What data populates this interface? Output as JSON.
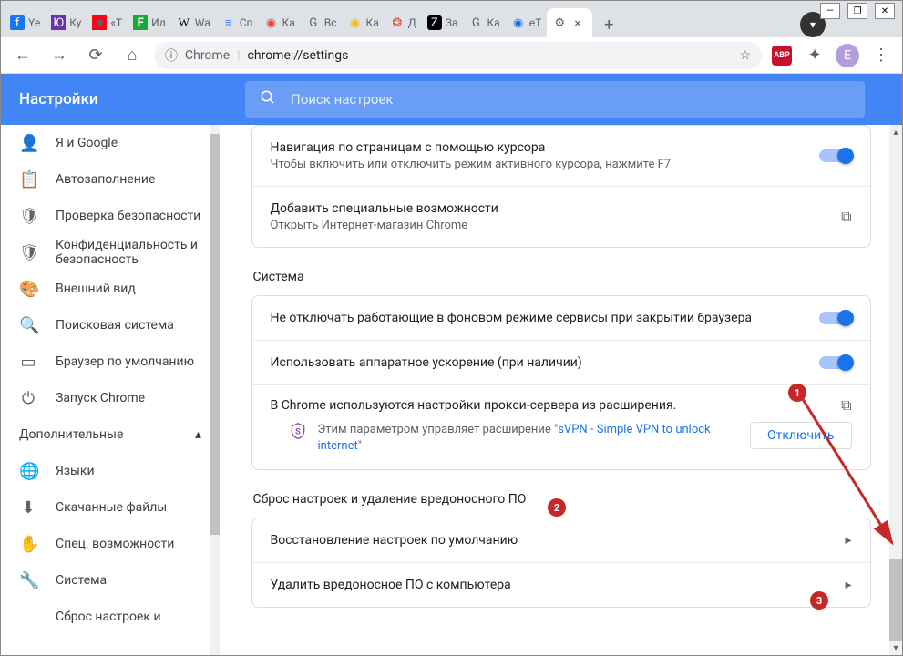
{
  "window": {
    "minimize": "—",
    "maximize": "❐",
    "close": "✕"
  },
  "tabs": [
    {
      "icon": "f",
      "title": "Ye",
      "cls": "fb"
    },
    {
      "icon": "Ю",
      "title": "Ку",
      "cls": "yk"
    },
    {
      "icon": "■",
      "title": "«Т",
      "cls": "red"
    },
    {
      "icon": "F",
      "title": "Ил",
      "cls": "grn"
    },
    {
      "icon": "W",
      "title": "Wa",
      "cls": "wk"
    },
    {
      "icon": "≡",
      "title": "Сп",
      "cls": "gd"
    },
    {
      "icon": "◉",
      "title": "Ка",
      "cls": "mc1"
    },
    {
      "icon": "G",
      "title": "Вс",
      "cls": ""
    },
    {
      "icon": "◉",
      "title": "Ка",
      "cls": "mc2"
    },
    {
      "icon": "❂",
      "title": "Д",
      "cls": "mc3"
    },
    {
      "icon": "Z",
      "title": "За",
      "cls": "zen"
    },
    {
      "icon": "G",
      "title": "Ка",
      "cls": ""
    },
    {
      "icon": "◉",
      "title": "eT",
      "cls": "pl"
    },
    {
      "icon": "⚙",
      "title": "",
      "cls": "gear",
      "active": true
    }
  ],
  "addr": {
    "chrome_label": "Chrome",
    "url": "chrome://settings",
    "abp": "ABP",
    "avatar": "E"
  },
  "header": {
    "title": "Настройки",
    "search_placeholder": "Поиск настроек"
  },
  "sidebar": {
    "items": [
      {
        "icon": "👤",
        "label": "Я и Google"
      },
      {
        "icon": "📋",
        "label": "Автозаполнение"
      },
      {
        "icon": "🛡",
        "label": "Проверка безопасности"
      },
      {
        "icon": "🛡",
        "label": "Конфиденциальность и безопасность"
      },
      {
        "icon": "🎨",
        "label": "Внешний вид"
      },
      {
        "icon": "🔍",
        "label": "Поисковая система"
      },
      {
        "icon": "▭",
        "label": "Браузер по умолчанию"
      },
      {
        "icon": "⏻",
        "label": "Запуск Chrome"
      }
    ],
    "advanced": "Дополнительные",
    "adv_items": [
      {
        "icon": "🌐",
        "label": "Языки"
      },
      {
        "icon": "⬇",
        "label": "Скачанные файлы"
      },
      {
        "icon": "✋",
        "label": "Спец. возможности"
      },
      {
        "icon": "🔧",
        "label": "Система"
      },
      {
        "icon": "",
        "label": "Сброс настроек и"
      }
    ]
  },
  "main": {
    "caret_nav": {
      "title": "Навигация по страницам с помощью курсора",
      "sub": "Чтобы включить или отключить режим активного курсора, нажмите F7"
    },
    "add_a11y": {
      "title": "Добавить специальные возможности",
      "sub": "Открыть Интернет-магазин Chrome"
    },
    "system_h": "Система",
    "bg_apps": "Не отключать работающие в фоновом режиме сервисы при закрытии браузера",
    "hw_accel": "Использовать аппаратное ускорение (при наличии)",
    "proxy": "В Chrome используются настройки прокси-сервера из расширения.",
    "proxy_note_pre": "Этим параметром управляет расширение \"",
    "proxy_link": "sVPN - Simple VPN to unlock internet",
    "proxy_note_post": "\"",
    "disable_btn": "Отключить",
    "reset_h": "Сброс настроек и удаление вредоносного ПО",
    "reset_default": "Восстановление настроек по умолчанию",
    "cleanup": "Удалить вредоносное ПО с компьютера"
  },
  "annotations": {
    "a1": "1",
    "a2": "2",
    "a3": "3"
  }
}
